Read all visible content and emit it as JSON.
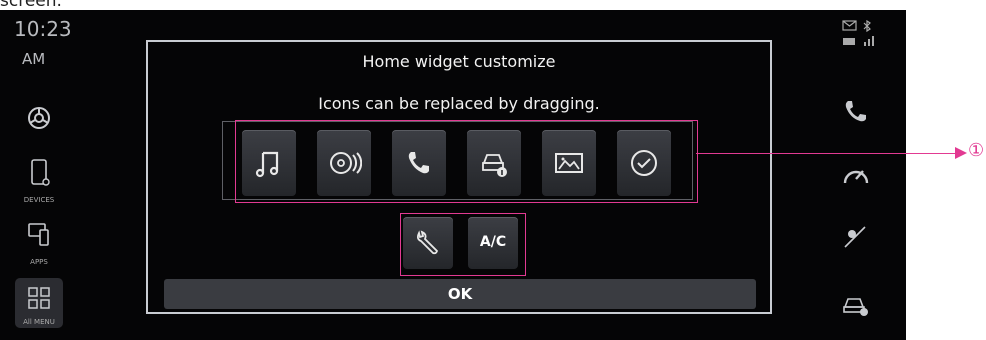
{
  "caption": "screen.",
  "clock": {
    "time": "10:23",
    "ampm": "AM"
  },
  "left_sidebar": {
    "devices_label": "DEVICES",
    "apps_label": "APPS",
    "allmenu_label": "All MENU"
  },
  "dialog": {
    "title": "Home widget customize",
    "subtitle": "Icons can be replaced by dragging.",
    "row1_icons": [
      "music-icon",
      "radio-disc-icon",
      "phone-icon",
      "car-info-icon",
      "gallery-icon",
      "clock-check-icon"
    ],
    "row2": {
      "wrench_icon": "wrench-icon",
      "ac_label": "A/C"
    },
    "ok_label": "OK"
  },
  "callout": {
    "number": "①"
  },
  "colors": {
    "accent": "#e23a92",
    "background": "#050506",
    "panel": "#3a3c41"
  }
}
